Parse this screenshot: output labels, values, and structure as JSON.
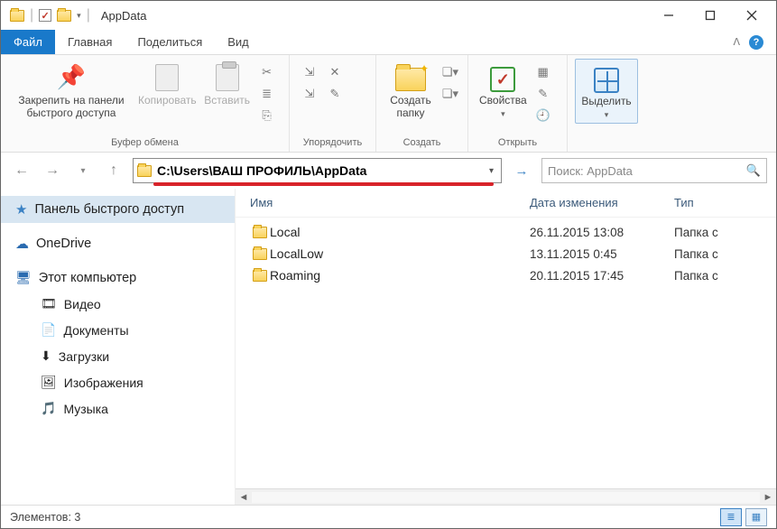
{
  "window": {
    "title": "AppData"
  },
  "tabs": {
    "file": "Файл",
    "home": "Главная",
    "share": "Поделиться",
    "view": "Вид"
  },
  "ribbon": {
    "pin": "Закрепить на панели\nбыстрого доступа",
    "copy": "Копировать",
    "paste": "Вставить",
    "group_clipboard": "Буфер обмена",
    "group_organize": "Упорядочить",
    "newfolder": "Создать\nпапку",
    "group_create": "Создать",
    "properties": "Свойства",
    "group_open": "Открыть",
    "select": "Выделить"
  },
  "address": {
    "path": "C:\\Users\\ВАШ ПРОФИЛЬ\\AppData"
  },
  "search": {
    "placeholder": "Поиск: AppData"
  },
  "sidebar": {
    "quick": "Панель быстрого доступ",
    "onedrive": "OneDrive",
    "thispc": "Этот компьютер",
    "videos": "Видео",
    "documents": "Документы",
    "downloads": "Загрузки",
    "pictures": "Изображения",
    "music": "Музыка"
  },
  "columns": {
    "name": "Имя",
    "date": "Дата изменения",
    "type": "Тип"
  },
  "rows": [
    {
      "name": "Local",
      "date": "26.11.2015 13:08",
      "type": "Папка с"
    },
    {
      "name": "LocalLow",
      "date": "13.11.2015 0:45",
      "type": "Папка с"
    },
    {
      "name": "Roaming",
      "date": "20.11.2015 17:45",
      "type": "Папка с"
    }
  ],
  "status": {
    "count": "Элементов: 3"
  }
}
